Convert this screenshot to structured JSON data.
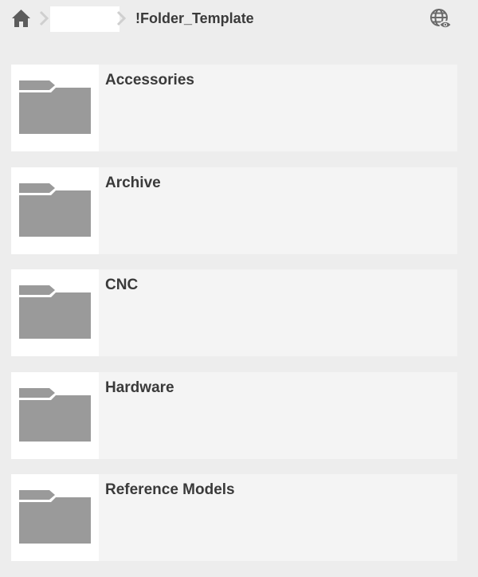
{
  "breadcrumb": {
    "home_icon": "home-icon",
    "hidden_segment": "",
    "current": "!Folder_Template"
  },
  "header": {
    "action_icon": "globe-eye-icon"
  },
  "colors": {
    "background": "#ededed",
    "card": "#f4f4f4",
    "folder_icon": "#9a9a9a",
    "text": "#3a3a3a"
  },
  "folders": [
    {
      "name": "Accessories",
      "icon": "folder-icon"
    },
    {
      "name": "Archive",
      "icon": "folder-icon"
    },
    {
      "name": "CNC",
      "icon": "folder-icon"
    },
    {
      "name": "Hardware",
      "icon": "folder-icon"
    },
    {
      "name": "Reference Models",
      "icon": "folder-icon"
    }
  ]
}
